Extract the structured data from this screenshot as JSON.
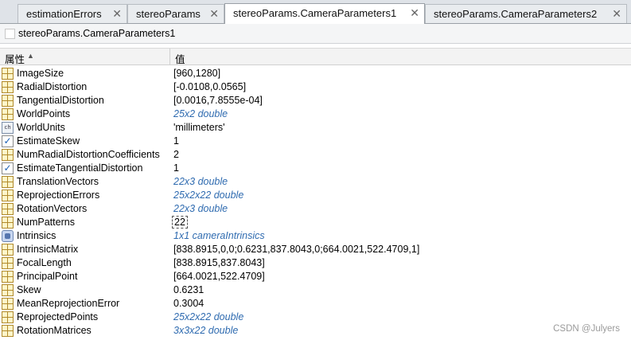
{
  "tabs": [
    {
      "label": "estimationErrors",
      "active": false
    },
    {
      "label": "stereoParams",
      "active": false
    },
    {
      "label": "stereoParams.CameraParameters1",
      "active": true
    },
    {
      "label": "stereoParams.CameraParameters2",
      "active": false
    }
  ],
  "close_glyph": "✕",
  "variable_title": "stereoParams.CameraParameters1",
  "columns": {
    "property": "属性",
    "value": "值"
  },
  "rows": [
    {
      "icon": "grid",
      "name": "ImageSize",
      "value": "[960,1280]",
      "style": "plain"
    },
    {
      "icon": "grid",
      "name": "RadialDistortion",
      "value": "[-0.0108,0.0565]",
      "style": "plain"
    },
    {
      "icon": "grid",
      "name": "TangentialDistortion",
      "value": "[0.0016,7.8555e-04]",
      "style": "plain"
    },
    {
      "icon": "grid",
      "name": "WorldPoints",
      "value": "25x2 double",
      "style": "link"
    },
    {
      "icon": "char",
      "name": "WorldUnits",
      "value": "'millimeters'",
      "style": "plain"
    },
    {
      "icon": "check",
      "name": "EstimateSkew",
      "value": "1",
      "style": "plain"
    },
    {
      "icon": "grid",
      "name": "NumRadialDistortionCoefficients",
      "value": "2",
      "style": "plain"
    },
    {
      "icon": "check",
      "name": "EstimateTangentialDistortion",
      "value": "1",
      "style": "plain"
    },
    {
      "icon": "grid",
      "name": "TranslationVectors",
      "value": "22x3 double",
      "style": "link"
    },
    {
      "icon": "grid",
      "name": "ReprojectionErrors",
      "value": "25x2x22 double",
      "style": "link"
    },
    {
      "icon": "grid",
      "name": "RotationVectors",
      "value": "22x3 double",
      "style": "link"
    },
    {
      "icon": "grid",
      "name": "NumPatterns",
      "value": "22",
      "style": "boxed"
    },
    {
      "icon": "object",
      "name": "Intrinsics",
      "value": "1x1 cameraIntrinsics",
      "style": "link"
    },
    {
      "icon": "grid",
      "name": "IntrinsicMatrix",
      "value": "[838.8915,0,0;0.6231,837.8043,0;664.0021,522.4709,1]",
      "style": "plain"
    },
    {
      "icon": "grid",
      "name": "FocalLength",
      "value": "[838.8915,837.8043]",
      "style": "plain"
    },
    {
      "icon": "grid",
      "name": "PrincipalPoint",
      "value": "[664.0021,522.4709]",
      "style": "plain"
    },
    {
      "icon": "grid",
      "name": "Skew",
      "value": "0.6231",
      "style": "plain"
    },
    {
      "icon": "grid",
      "name": "MeanReprojectionError",
      "value": "0.3004",
      "style": "plain"
    },
    {
      "icon": "grid",
      "name": "ReprojectedPoints",
      "value": "25x2x22 double",
      "style": "link"
    },
    {
      "icon": "grid",
      "name": "RotationMatrices",
      "value": "3x3x22 double",
      "style": "link"
    }
  ],
  "watermark": "CSDN @Julyers",
  "colors": {
    "link": "#2f6bb0",
    "tab_bg": "#e9ecef",
    "active_tab_bg": "#ffffff"
  }
}
